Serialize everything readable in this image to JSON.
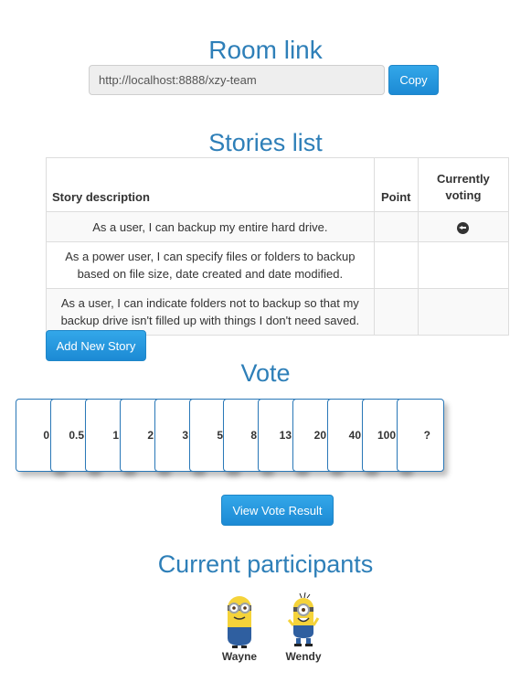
{
  "room": {
    "heading": "Room link",
    "link_value": "http://localhost:8888/xzy-team",
    "copy_label": "Copy"
  },
  "stories": {
    "heading": "Stories list",
    "columns": {
      "description": "Story description",
      "point": "Point",
      "currently_voting": "Currently voting"
    },
    "rows": [
      {
        "description": "As a user, I can backup my entire hard drive.",
        "point": "",
        "currently_voting": true
      },
      {
        "description": "As a power user, I can specify files or folders to backup based on file size, date created and date modified.",
        "point": "",
        "currently_voting": false
      },
      {
        "description": "As a user, I can indicate folders not to backup so that my backup drive isn't filled up with things I don't need saved.",
        "point": "",
        "currently_voting": false
      }
    ],
    "current_icon": "circle-arrow-left-icon",
    "add_label": "Add New Story"
  },
  "vote": {
    "heading": "Vote",
    "cards": [
      "0",
      "0.5",
      "1",
      "2",
      "3",
      "5",
      "8",
      "13",
      "20",
      "40",
      "100",
      "?"
    ],
    "result_label": "View Vote Result"
  },
  "participants": {
    "heading": "Current participants",
    "people": [
      {
        "name": "Wayne",
        "avatar": "minion-two-eyed-avatar"
      },
      {
        "name": "Wendy",
        "avatar": "minion-one-eyed-avatar"
      }
    ]
  },
  "colors": {
    "heading": "#2e7fb8",
    "primary_button": "#2599dd",
    "card_border": "#2a78b8"
  }
}
